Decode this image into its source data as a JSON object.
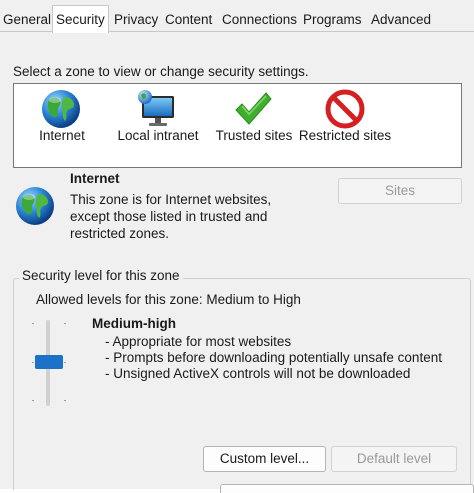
{
  "tabs": [
    "General",
    "Security",
    "Privacy",
    "Content",
    "Connections",
    "Programs",
    "Advanced"
  ],
  "active_tab": "Security",
  "zone_prompt": "Select a zone to view or change security settings.",
  "zones": [
    {
      "label": "Internet",
      "icon": "globe-icon",
      "selected": true
    },
    {
      "label": "Local intranet",
      "icon": "intranet-globe-monitor-icon"
    },
    {
      "label": "Trusted sites",
      "icon": "green-checkmark-icon"
    },
    {
      "label": "Restricted sites",
      "icon": "red-prohibited-icon"
    }
  ],
  "selected_zone": {
    "title": "Internet",
    "description_lines": [
      "This zone is for Internet websites,",
      "except those listed in trusted and",
      "restricted zones."
    ],
    "sites_button": "Sites"
  },
  "security_level": {
    "group_title": "Security level for this zone",
    "allowed": "Allowed levels for this zone: Medium to High",
    "level_name": "Medium-high",
    "bullets": [
      "- Appropriate for most websites",
      "- Prompts before downloading potentially unsafe content",
      "- Unsigned ActiveX controls will not be downloaded"
    ],
    "custom_button": "Custom level...",
    "default_button": "Default level"
  },
  "colors": {
    "accent": "#1a73c8",
    "panel_bg": "#f0f0f0",
    "check_green": "#3fae2a",
    "restricted_red": "#d42020"
  }
}
